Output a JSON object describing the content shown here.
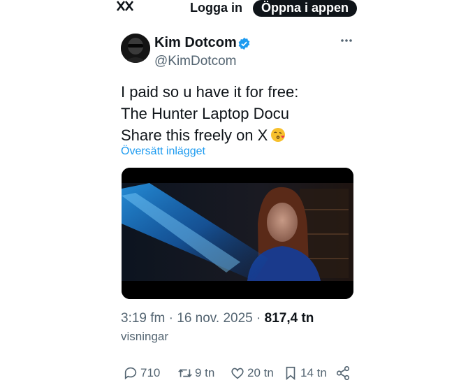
{
  "header": {
    "login_label": "Logga in",
    "open_app_label": "Öppna i appen",
    "logo_icon": "x-logo-icon"
  },
  "author": {
    "name": "Kim Dotcom",
    "handle": "@KimDotcom",
    "verified": true,
    "verified_color": "#1d9bf0"
  },
  "tweet": {
    "lines": [
      "I paid so u have it for free:",
      "The Hunter Laptop Docu",
      "Share this freely on X"
    ],
    "emoji": "kissing-face-emoji",
    "translate_label": "Översätt inlägget"
  },
  "meta": {
    "time": "3:19 fm",
    "separator": " · ",
    "date": "16 nov. 2025",
    "separator2": " · ",
    "views": "817,4 tn",
    "views_label": "visningar"
  },
  "actions": {
    "replies": "710",
    "reposts": "9 tn",
    "likes": "20 tn",
    "bookmarks": "14 tn"
  },
  "colors": {
    "accent": "#1d9bf0",
    "text": "#0f1419",
    "muted": "#536471"
  }
}
